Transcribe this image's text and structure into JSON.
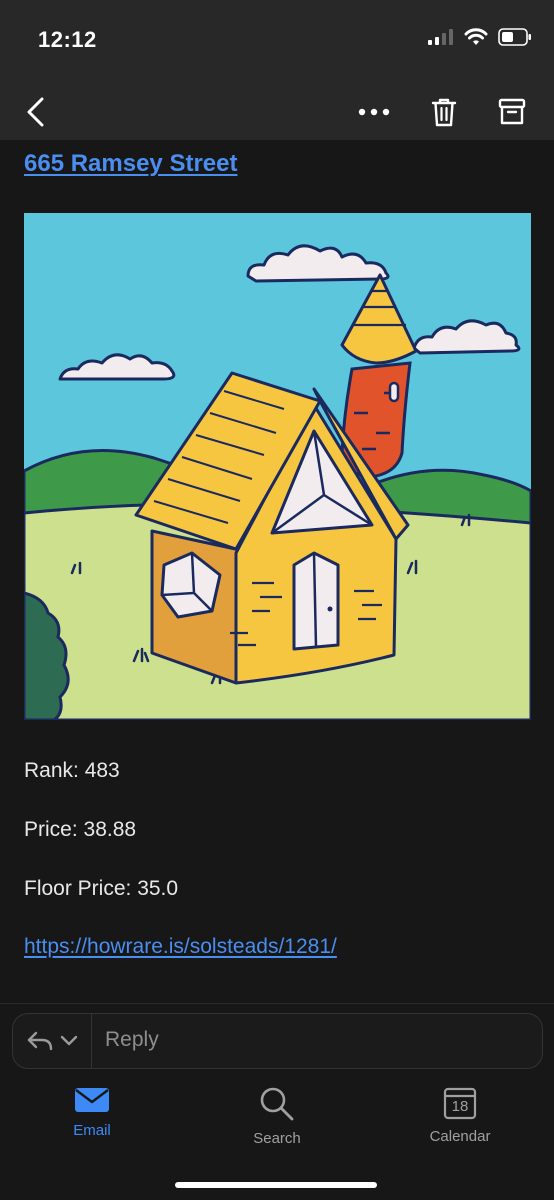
{
  "status_bar": {
    "time": "12:12"
  },
  "email": {
    "title_link": "665 Ramsey Street",
    "rank": "Rank: 483",
    "price": "Price: 38.88",
    "floor_price": "Floor Price: 35.0",
    "url": "https://howrare.is/solsteads/1281/"
  },
  "reply": {
    "placeholder": "Reply"
  },
  "tabs": [
    {
      "label": "Email",
      "icon": "envelope-icon",
      "active": true
    },
    {
      "label": "Search",
      "icon": "search-icon",
      "active": false
    },
    {
      "label": "Calendar",
      "icon": "calendar-icon",
      "active": false,
      "badge": "18"
    }
  ],
  "colors": {
    "accent": "#3d8af7",
    "link": "#4a8ef0",
    "background": "#171717",
    "bar": "#282828"
  }
}
